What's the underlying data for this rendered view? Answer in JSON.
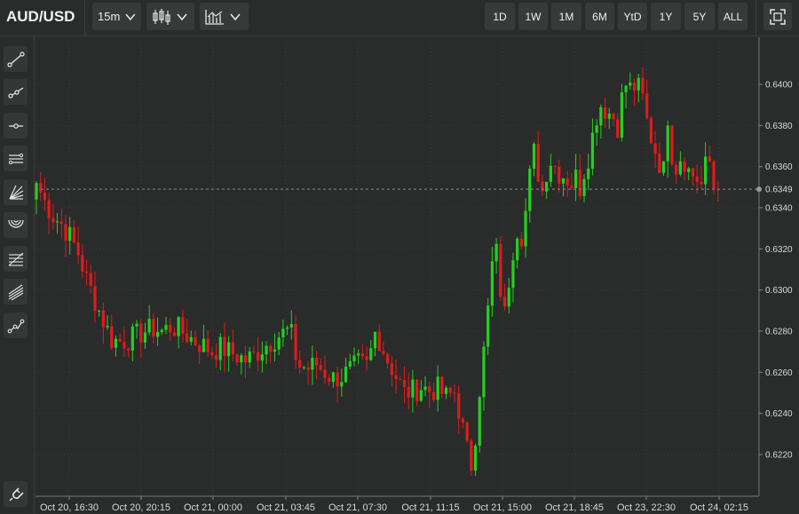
{
  "header": {
    "symbol": "AUD/USD",
    "interval": "15m",
    "chart_style_icon": "candlestick-icon",
    "indicators_icon": "indicators-icon",
    "ranges": [
      "1D",
      "1W",
      "1M",
      "6M",
      "YtD",
      "1Y",
      "5Y",
      "ALL"
    ],
    "fullscreen_icon": "fullscreen-icon"
  },
  "toolbar": {
    "tools": [
      {
        "icon": "trend-line-icon"
      },
      {
        "icon": "ray-icon"
      },
      {
        "icon": "horizontal-line-icon"
      },
      {
        "icon": "parallel-channel-icon"
      },
      {
        "icon": "fan-icon"
      },
      {
        "icon": "arc-icon"
      },
      {
        "icon": "fibonacci-icon"
      },
      {
        "icon": "pitchfork-icon"
      },
      {
        "icon": "path-icon"
      }
    ],
    "bottom_icon": "magnet-icon"
  },
  "chart_data": {
    "type": "candlestick",
    "title": "AUD/USD",
    "interval": "15m",
    "y_ticks": [
      "0.6220",
      "0.6240",
      "0.6260",
      "0.6280",
      "0.6300",
      "0.6320",
      "0.6340",
      "0.6360",
      "0.6380",
      "0.6400"
    ],
    "ylim": [
      0.6205,
      0.6418
    ],
    "x_ticks": [
      "Oct 20, 16:30",
      "Oct 20, 20:15",
      "Oct 21, 00:00",
      "Oct 21, 03:45",
      "Oct 21, 07:30",
      "Oct 21, 11:15",
      "Oct 21, 15:00",
      "Oct 21, 18:45",
      "Oct 23, 22:30",
      "Oct 24, 02:15"
    ],
    "last_price": "0.6349",
    "grid": true,
    "up_color": "#22d11f",
    "down_color": "#e01b1b",
    "price_path": [
      [
        0,
        0.6352
      ],
      [
        2,
        0.6343
      ],
      [
        4,
        0.6336
      ],
      [
        6,
        0.6332
      ],
      [
        8,
        0.6326
      ],
      [
        10,
        0.6318
      ],
      [
        12,
        0.6305
      ],
      [
        14,
        0.6295
      ],
      [
        16,
        0.6285
      ],
      [
        18,
        0.6276
      ],
      [
        20,
        0.6275
      ],
      [
        22,
        0.6276
      ],
      [
        24,
        0.6278
      ],
      [
        26,
        0.628
      ],
      [
        28,
        0.6281
      ],
      [
        30,
        0.628
      ],
      [
        32,
        0.6282
      ],
      [
        34,
        0.6281
      ],
      [
        36,
        0.6278
      ],
      [
        38,
        0.6275
      ],
      [
        40,
        0.6273
      ],
      [
        42,
        0.627
      ],
      [
        44,
        0.6272
      ],
      [
        46,
        0.627
      ],
      [
        48,
        0.6268
      ],
      [
        50,
        0.6266
      ],
      [
        52,
        0.6268
      ],
      [
        54,
        0.6272
      ],
      [
        56,
        0.6275
      ],
      [
        58,
        0.6278
      ],
      [
        60,
        0.628
      ],
      [
        61,
        0.6278
      ],
      [
        62,
        0.6268
      ],
      [
        63,
        0.6263
      ],
      [
        65,
        0.6262
      ],
      [
        67,
        0.6264
      ],
      [
        69,
        0.626
      ],
      [
        71,
        0.6257
      ],
      [
        73,
        0.6258
      ],
      [
        75,
        0.6261
      ],
      [
        77,
        0.6264
      ],
      [
        79,
        0.6263
      ],
      [
        80,
        0.627
      ],
      [
        81,
        0.6279
      ],
      [
        82,
        0.6276
      ],
      [
        84,
        0.6266
      ],
      [
        86,
        0.6258
      ],
      [
        88,
        0.625
      ],
      [
        90,
        0.6251
      ],
      [
        92,
        0.6253
      ],
      [
        94,
        0.6251
      ],
      [
        96,
        0.6252
      ],
      [
        98,
        0.6248
      ],
      [
        100,
        0.625
      ],
      [
        101,
        0.6242
      ],
      [
        102,
        0.6232
      ],
      [
        103,
        0.6222
      ],
      [
        104,
        0.6215
      ],
      [
        105,
        0.623
      ],
      [
        106,
        0.6252
      ],
      [
        107,
        0.627
      ],
      [
        108,
        0.629
      ],
      [
        109,
        0.6312
      ],
      [
        110,
        0.6318
      ],
      [
        111,
        0.63
      ],
      [
        112,
        0.6288
      ],
      [
        113,
        0.6305
      ],
      [
        114,
        0.632
      ],
      [
        115,
        0.633
      ],
      [
        116,
        0.6327
      ],
      [
        117,
        0.6338
      ],
      [
        118,
        0.6355
      ],
      [
        119,
        0.6367
      ],
      [
        120,
        0.6357
      ],
      [
        121,
        0.6348
      ],
      [
        122,
        0.6358
      ],
      [
        123,
        0.6363
      ],
      [
        124,
        0.636
      ],
      [
        125,
        0.6357
      ],
      [
        126,
        0.6356
      ],
      [
        127,
        0.6354
      ],
      [
        128,
        0.6352
      ],
      [
        129,
        0.6355
      ],
      [
        130,
        0.635
      ],
      [
        131,
        0.6358
      ],
      [
        132,
        0.6365
      ],
      [
        133,
        0.6375
      ],
      [
        134,
        0.6385
      ],
      [
        135,
        0.639
      ],
      [
        136,
        0.6388
      ],
      [
        137,
        0.6386
      ],
      [
        138,
        0.6384
      ],
      [
        139,
        0.638
      ],
      [
        140,
        0.6393
      ],
      [
        141,
        0.64
      ],
      [
        142,
        0.6398
      ],
      [
        143,
        0.6399
      ],
      [
        144,
        0.6398
      ],
      [
        145,
        0.6393
      ],
      [
        146,
        0.6382
      ],
      [
        147,
        0.6374
      ],
      [
        148,
        0.6368
      ],
      [
        149,
        0.6362
      ],
      [
        150,
        0.6358
      ],
      [
        151,
        0.6385
      ],
      [
        152,
        0.6366
      ],
      [
        153,
        0.636
      ],
      [
        154,
        0.6365
      ],
      [
        155,
        0.6363
      ],
      [
        156,
        0.6358
      ],
      [
        157,
        0.6356
      ],
      [
        158,
        0.6354
      ],
      [
        159,
        0.6351
      ],
      [
        160,
        0.636
      ],
      [
        161,
        0.6362
      ],
      [
        162,
        0.635
      ],
      [
        163,
        0.6349
      ]
    ]
  }
}
